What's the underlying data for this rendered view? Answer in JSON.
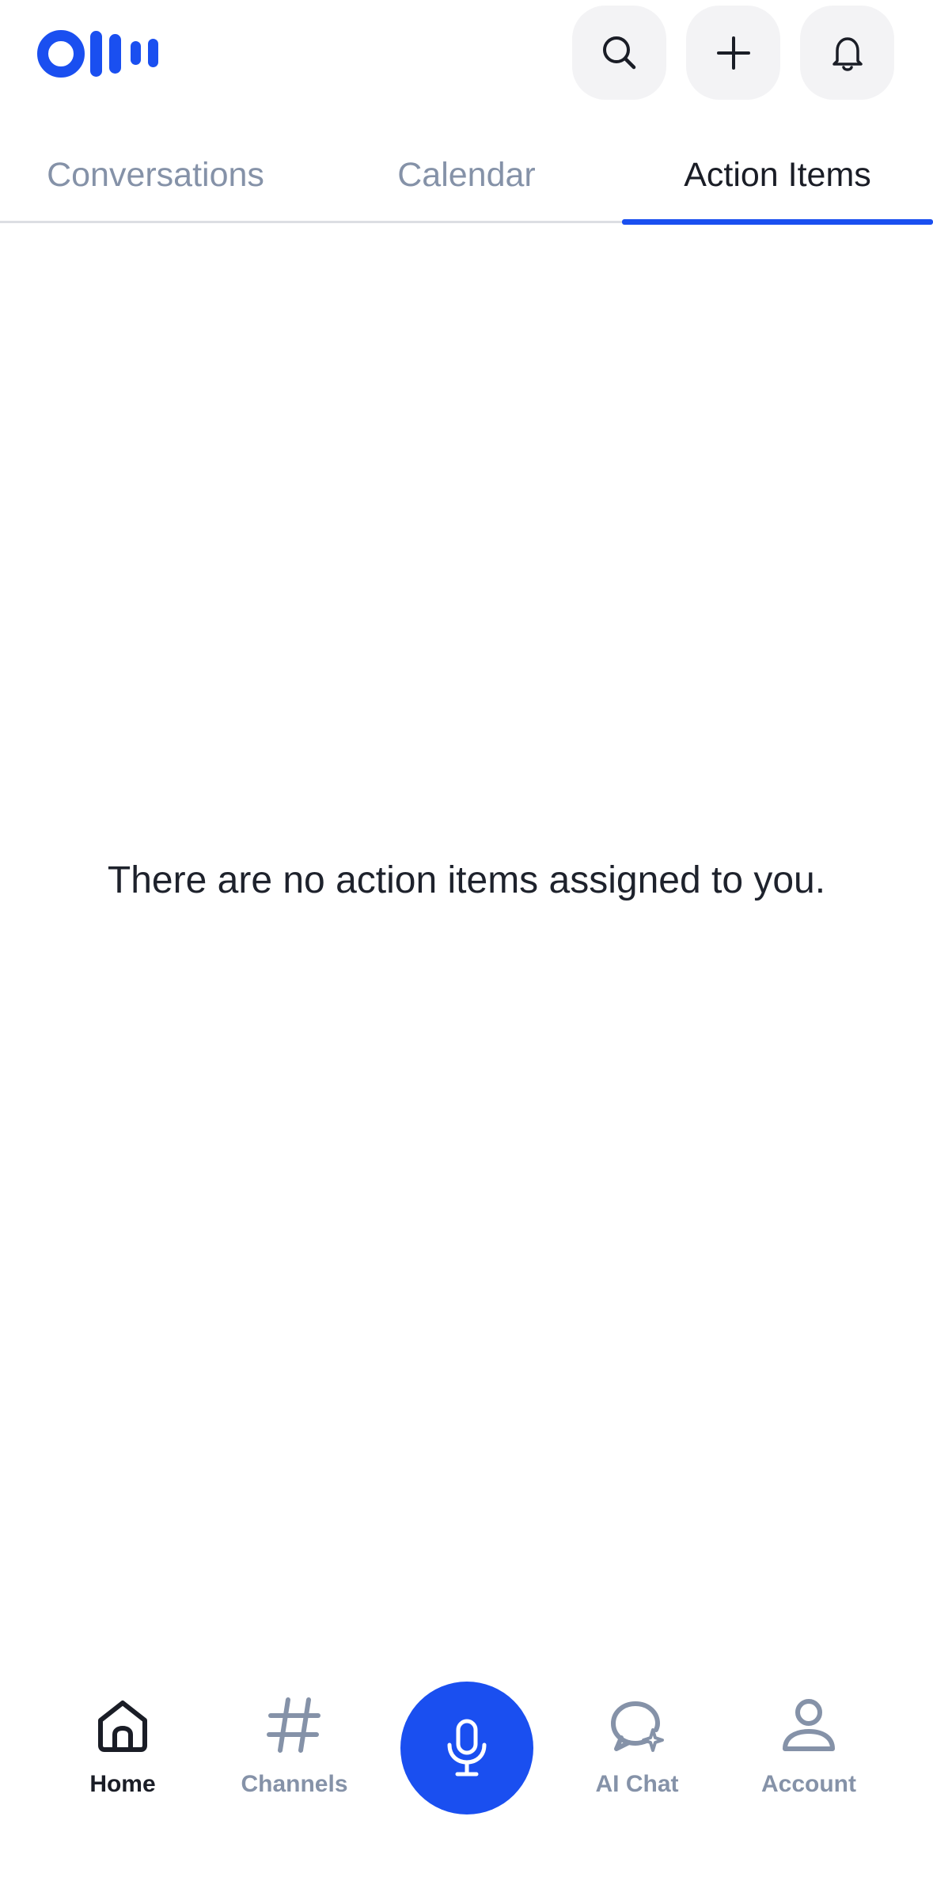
{
  "app": {
    "brand_color": "#1a4ff0",
    "logo_icon": "otter-logo"
  },
  "header": {
    "buttons": [
      {
        "icon": "search-icon"
      },
      {
        "icon": "plus-icon"
      },
      {
        "icon": "bell-icon"
      }
    ]
  },
  "tabs": [
    {
      "label": "Conversations",
      "active": false
    },
    {
      "label": "Calendar",
      "active": false
    },
    {
      "label": "Action Items",
      "active": true
    }
  ],
  "main": {
    "empty_message": "There are no action items assigned to you."
  },
  "bottom_nav": {
    "items": [
      {
        "label": "Home",
        "icon": "home-icon",
        "active": true
      },
      {
        "label": "Channels",
        "icon": "hashtag-icon",
        "active": false
      },
      {
        "label": "AI Chat",
        "icon": "ai-chat-icon",
        "active": false
      },
      {
        "label": "Account",
        "icon": "user-icon",
        "active": false
      }
    ],
    "record_icon": "microphone-icon"
  },
  "colors": {
    "active_text": "#1a1d26",
    "inactive_text": "#8592a8",
    "button_bg": "#f3f3f5"
  }
}
